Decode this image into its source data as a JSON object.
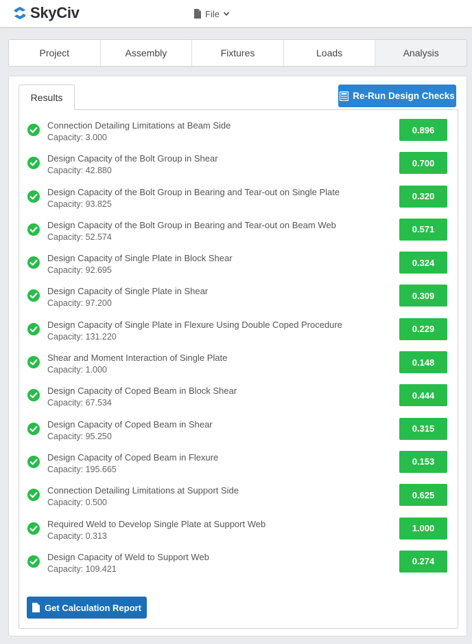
{
  "header": {
    "brand": "SkyCiv",
    "file_menu": "File"
  },
  "tabs": [
    {
      "label": "Project",
      "active": false
    },
    {
      "label": "Assembly",
      "active": false
    },
    {
      "label": "Fixtures",
      "active": false
    },
    {
      "label": "Loads",
      "active": false
    },
    {
      "label": "Analysis",
      "active": true
    }
  ],
  "results": {
    "tab_label": "Results",
    "rerun_label": "Re-Run Design Checks",
    "report_label": "Get Calculation Report",
    "pass_color": "#27bd4a",
    "checks": [
      {
        "title": "Connection Detailing Limitations at Beam Side",
        "capacity": "Capacity: 3.000",
        "ratio": "0.896"
      },
      {
        "title": "Design Capacity of the Bolt Group in Shear",
        "capacity": "Capacity: 42.880",
        "ratio": "0.700"
      },
      {
        "title": "Design Capacity of the Bolt Group in Bearing and Tear-out on Single Plate",
        "capacity": "Capacity: 93.825",
        "ratio": "0.320"
      },
      {
        "title": "Design Capacity of the Bolt Group in Bearing and Tear-out on Beam Web",
        "capacity": "Capacity: 52.574",
        "ratio": "0.571"
      },
      {
        "title": "Design Capacity of Single Plate in Block Shear",
        "capacity": "Capacity: 92.695",
        "ratio": "0.324"
      },
      {
        "title": "Design Capacity of Single Plate in Shear",
        "capacity": "Capacity: 97.200",
        "ratio": "0.309"
      },
      {
        "title": "Design Capacity of Single Plate in Flexure Using Double Coped Procedure",
        "capacity": "Capacity: 131.220",
        "ratio": "0.229"
      },
      {
        "title": "Shear and Moment Interaction of Single Plate",
        "capacity": "Capacity: 1.000",
        "ratio": "0.148"
      },
      {
        "title": "Design Capacity of Coped Beam in Block Shear",
        "capacity": "Capacity: 67.534",
        "ratio": "0.444"
      },
      {
        "title": "Design Capacity of Coped Beam in Shear",
        "capacity": "Capacity: 95.250",
        "ratio": "0.315"
      },
      {
        "title": "Design Capacity of Coped Beam in Flexure",
        "capacity": "Capacity: 195.665",
        "ratio": "0.153"
      },
      {
        "title": "Connection Detailing Limitations at Support Side",
        "capacity": "Capacity: 0.500",
        "ratio": "0.625"
      },
      {
        "title": "Required Weld to Develop Single Plate at Support Web",
        "capacity": "Capacity: 0.313",
        "ratio": "1.000"
      },
      {
        "title": "Design Capacity of Weld to Support Web",
        "capacity": "Capacity: 109.421",
        "ratio": "0.274"
      }
    ]
  }
}
